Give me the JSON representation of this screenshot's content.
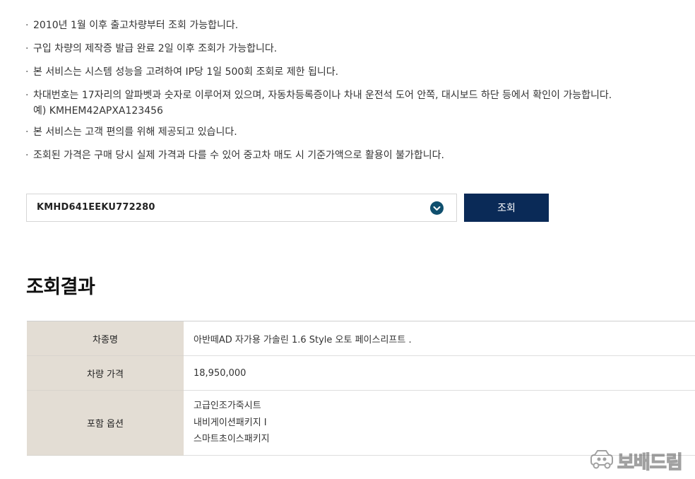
{
  "notices": [
    {
      "text": "2010년 1월 이후 출고차량부터 조회 가능합니다."
    },
    {
      "text": "구입 차량의 제작증 발급 완료 2일 이후 조회가 가능합니다."
    },
    {
      "text": "본 서비스는 시스템 성능을 고려하여 IP당 1일 500회 조회로 제한 됩니다."
    },
    {
      "text": "차대번호는 17자리의 알파벳과 숫자로 이루어져 있으며, 자동차등록증이나 차내 운전석 도어 안쪽, 대시보드 하단 등에서 확인이 가능합니다.",
      "sub": "예) KMHEM42APXA123456"
    },
    {
      "text": "본 서비스는 고객 편의를 위해 제공되고 있습니다."
    },
    {
      "text": "조회된 가격은 구매 당시 실제 가격과 다를 수 있어 중고차 매도 시 기준가액으로 활용이 불가합니다."
    }
  ],
  "search": {
    "vin_value": "KMHD641EEKU772280",
    "button_label": "조회",
    "chevron_icon": "chevron-down-icon",
    "button_color": "#0a2a57",
    "chevron_color": "#0f4f6e"
  },
  "result": {
    "title": "조회결과",
    "rows": {
      "model": {
        "label": "차종명",
        "value": "아반떼AD 자가용 가솔린 1.6 Style 오토 페이스리프트 ."
      },
      "price": {
        "label": "차량 가격",
        "value": "18,950,000"
      },
      "options": {
        "label": "포함 옵션",
        "items": [
          "고급인조가죽시트",
          "내비게이션패키지 I",
          "스마트초이스패키지"
        ]
      }
    },
    "header_bg": "#e3ddd4"
  },
  "watermark": {
    "text": "보배드림",
    "icon": "car-logo-icon"
  }
}
